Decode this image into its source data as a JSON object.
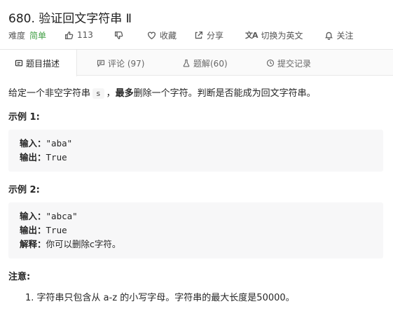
{
  "problem": {
    "title": "680. 验证回文字符串 Ⅱ",
    "difficulty_label": "难度",
    "difficulty": "简单",
    "likes": "113",
    "favorite_label": "收藏",
    "share_label": "分享",
    "switch_lang_label": "切换为英文",
    "follow_label": "关注",
    "difficulty_color": "#43a047"
  },
  "tabs": [
    {
      "label": "题目描述",
      "icon": "description-icon",
      "active": true
    },
    {
      "label": "评论 (97)",
      "icon": "comment-icon",
      "active": false
    },
    {
      "label": "题解(60)",
      "icon": "flask-icon",
      "active": false
    },
    {
      "label": "提交记录",
      "icon": "history-icon",
      "active": false
    }
  ],
  "description": {
    "intro_before": "给定一个非空字符串",
    "intro_code": "s",
    "intro_comma": "，",
    "intro_bold": "最多",
    "intro_after": "删除一个字符。判断是否能成为回文字符串。"
  },
  "examples": [
    {
      "title": "示例 1:",
      "lines": [
        {
          "key": "输入：",
          "value": "\"aba\""
        },
        {
          "key": "输出：",
          "value": "True"
        }
      ]
    },
    {
      "title": "示例 2:",
      "lines": [
        {
          "key": "输入：",
          "value": "\"abca\""
        },
        {
          "key": "输出：",
          "value": "True"
        },
        {
          "key": "解释：",
          "value": "你可以删除c字符。"
        }
      ]
    }
  ],
  "notes": {
    "title": "注意:",
    "items": [
      "字符串只包含从 a-z 的小写字母。字符串的最大长度是50000。"
    ],
    "item_number": "1."
  }
}
